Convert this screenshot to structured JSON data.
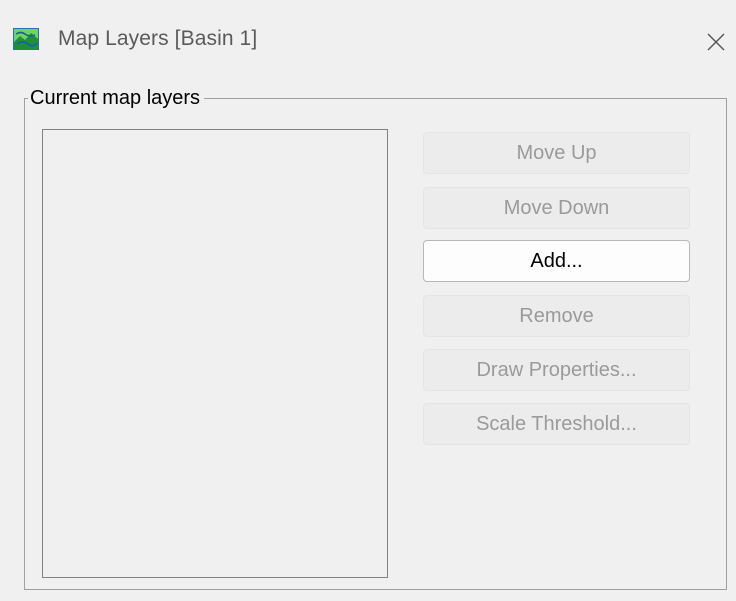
{
  "window": {
    "title": "Map Layers [Basin 1]",
    "close_icon": "close-icon",
    "app_icon": "map-icon"
  },
  "group": {
    "label": "Current map layers"
  },
  "layers": [],
  "buttons": {
    "move_up": "Move Up",
    "move_down": "Move Down",
    "add": "Add...",
    "remove": "Remove",
    "draw_properties": "Draw Properties...",
    "scale_threshold": "Scale Threshold..."
  },
  "button_states": {
    "move_up": "disabled",
    "move_down": "disabled",
    "add": "enabled",
    "remove": "disabled",
    "draw_properties": "disabled",
    "scale_threshold": "disabled"
  },
  "colors": {
    "window_bg": "#f0f0f0",
    "disabled_text": "#9a9a9a",
    "enabled_text": "#000000",
    "title_text": "#5a5a5a"
  }
}
